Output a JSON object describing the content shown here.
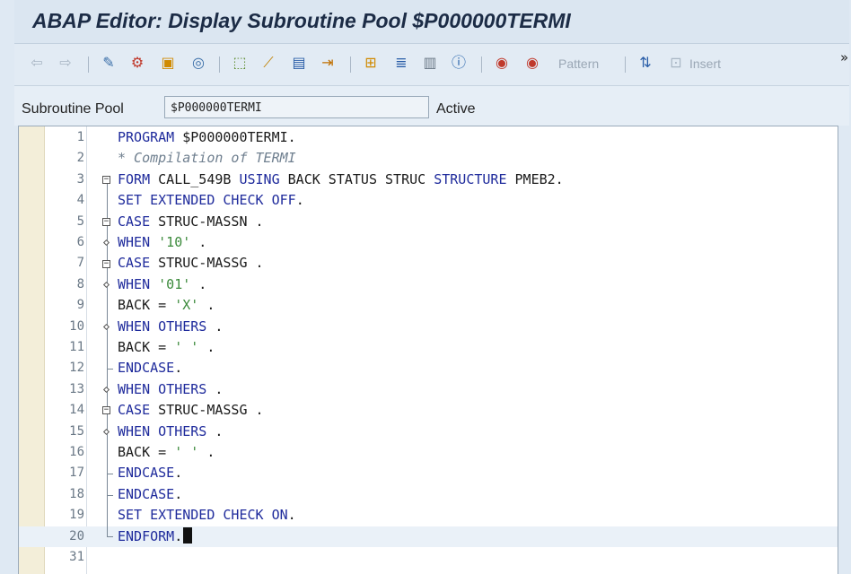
{
  "window": {
    "title": "ABAP Editor: Display Subroutine Pool $P000000TERMI"
  },
  "toolbar": {
    "pattern_label": "Pattern",
    "insert_label": "Insert",
    "more": "»"
  },
  "header": {
    "field_label": "Subroutine Pool",
    "field_value": "$P000000TERMI",
    "status": "Active"
  },
  "editor": {
    "line_numbers": [
      "1",
      "2",
      "3",
      "4",
      "5",
      "6",
      "7",
      "8",
      "9",
      "10",
      "11",
      "12",
      "13",
      "14",
      "15",
      "16",
      "17",
      "18",
      "19",
      "20",
      "31"
    ],
    "lines": [
      "PROGRAM $P000000TERMI.",
      "* Compilation of TERMI",
      "FORM CALL_549B USING BACK STATUS STRUC STRUCTURE PMEB2.",
      "SET EXTENDED CHECK OFF.",
      "CASE STRUC-MASSN .",
      "WHEN '10' .",
      "CASE STRUC-MASSG .",
      "WHEN '01' .",
      "BACK = 'X' .",
      "WHEN OTHERS .",
      "BACK = ' ' .",
      "ENDCASE.",
      "WHEN OTHERS .",
      "CASE STRUC-MASSG .",
      "WHEN OTHERS .",
      "BACK = ' ' .",
      "ENDCASE.",
      "ENDCASE.",
      "SET EXTENDED CHECK ON.",
      "ENDFORM.",
      ""
    ]
  },
  "colors": {
    "keyword": "#1f2b9c",
    "string": "#3b8a3b",
    "comment": "#6f7f8f",
    "current_line": "#eaf1f8"
  }
}
